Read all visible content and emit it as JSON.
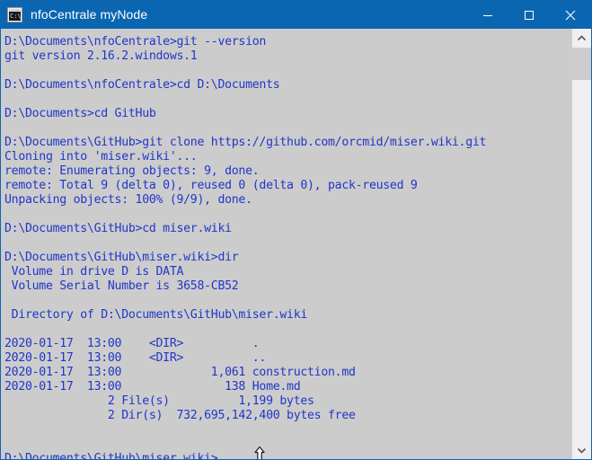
{
  "window": {
    "title": "nfoCentrale myNode",
    "icon": "cmd-console-icon",
    "icon_prompt_text": "C:\\",
    "titlebar_color": "#0b66b2",
    "border_color": "#1364ad",
    "console_background": "#cccccc",
    "console_text_color": "#2136c9"
  },
  "caption_buttons": {
    "minimize": "minimize",
    "maximize": "maximize",
    "close": "close"
  },
  "scrollbar": {
    "up_arrow": "scroll-up",
    "down_arrow": "scroll-down",
    "thumb": "scroll-thumb"
  },
  "console": {
    "lines": [
      "D:\\Documents\\nfoCentrale>git --version",
      "git version 2.16.2.windows.1",
      "",
      "D:\\Documents\\nfoCentrale>cd D:\\Documents",
      "",
      "D:\\Documents>cd GitHub",
      "",
      "D:\\Documents\\GitHub>git clone https://github.com/orcmid/miser.wiki.git",
      "Cloning into 'miser.wiki'...",
      "remote: Enumerating objects: 9, done.",
      "remote: Total 9 (delta 0), reused 0 (delta 0), pack-reused 9",
      "Unpacking objects: 100% (9/9), done.",
      "",
      "D:\\Documents\\GitHub>cd miser.wiki",
      "",
      "D:\\Documents\\GitHub\\miser.wiki>dir",
      " Volume in drive D is DATA",
      " Volume Serial Number is 3658-CB52",
      "",
      " Directory of D:\\Documents\\GitHub\\miser.wiki",
      "",
      "2020-01-17  13:00    <DIR>          .",
      "2020-01-17  13:00    <DIR>          ..",
      "2020-01-17  13:00             1,061 construction.md",
      "2020-01-17  13:00               138 Home.md",
      "               2 File(s)          1,199 bytes",
      "               2 Dir(s)  732,695,142,400 bytes free",
      "",
      ""
    ],
    "prompt_line": "D:\\Documents\\GitHub\\miser.wiki>"
  }
}
